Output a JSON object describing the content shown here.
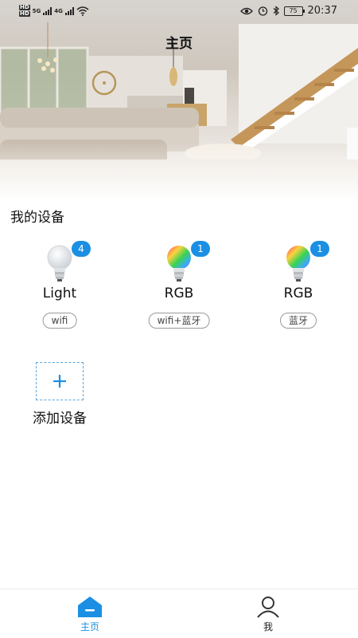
{
  "status_bar": {
    "network_left": "HD",
    "signal_1": "5G",
    "signal_2": "4G",
    "battery": "75",
    "time": "20:37"
  },
  "header": {
    "title": "主页"
  },
  "section": {
    "title": "我的设备"
  },
  "devices": [
    {
      "name": "Light",
      "tag": "wifi",
      "badge": "4",
      "icon": "bulb-white-icon"
    },
    {
      "name": "RGB",
      "tag": "wifi+蓝牙",
      "badge": "1",
      "icon": "bulb-rgb-icon"
    },
    {
      "name": "RGB",
      "tag": "蓝牙",
      "badge": "1",
      "icon": "bulb-rgb-icon"
    }
  ],
  "add_device": {
    "label": "添加设备",
    "icon": "plus-icon"
  },
  "tabbar": {
    "items": [
      {
        "label": "主页",
        "icon": "home-icon",
        "active": true
      },
      {
        "label": "我",
        "icon": "user-icon",
        "active": false
      }
    ]
  },
  "colors": {
    "accent": "#1a8fe3",
    "text": "#111111"
  }
}
